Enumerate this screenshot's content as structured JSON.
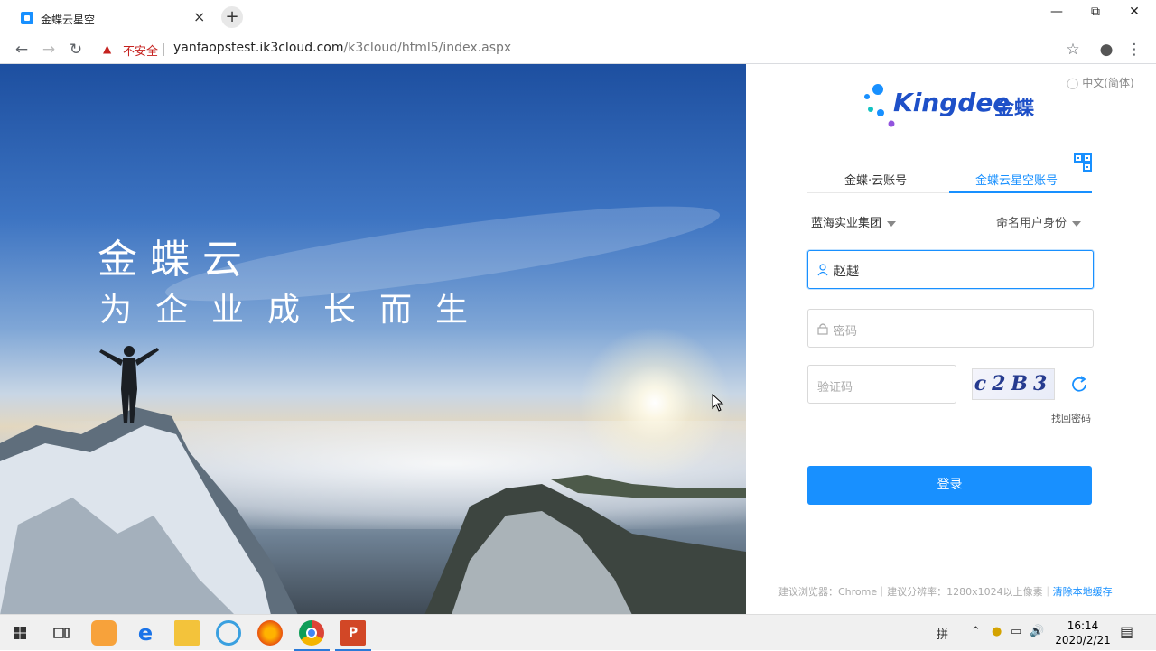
{
  "browser": {
    "tab_title": "金蝶云星空",
    "new_tab": "+",
    "tab_close": "×",
    "security_label": "不安全",
    "url_host": "yanfaopstest.ik3cloud.com",
    "url_path": "/k3cloud/html5/index.aspx"
  },
  "hero": {
    "title": "金蝶云",
    "slogan": "为企业成长而生"
  },
  "login": {
    "language": "中文(简体)",
    "brand": "Kingdee",
    "brand_cn": "金蝶",
    "tabs": [
      "金蝶·云账号",
      "金蝶云星空账号"
    ],
    "active_tab": 1,
    "organization": "蓝海实业集团",
    "identity": "命名用户身份",
    "username_value": "赵越",
    "password_placeholder": "密码",
    "captcha_placeholder": "验证码",
    "captcha_text": "c2B3",
    "forgot_password": "找回密码",
    "login_button": "登录",
    "footer_text": "建议浏览器：Chrome｜建议分辨率：1280x1024以上像素｜",
    "footer_link": "清除本地缓存"
  },
  "taskbar": {
    "time": "16:14",
    "date": "2020/2/21",
    "ime": "拼"
  },
  "colors": {
    "accent": "#1890ff",
    "insecure": "#c5221f"
  }
}
